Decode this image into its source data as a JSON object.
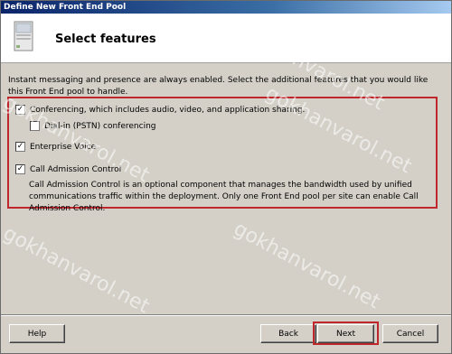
{
  "window": {
    "title": "Define New Front End Pool"
  },
  "header": {
    "title": "Select features",
    "icon": "server-icon"
  },
  "intro_text": "Instant messaging and presence are always enabled.  Select the additional features that you would like this Front End pool to handle.",
  "options": [
    {
      "label": "Conferencing, which includes audio, video, and application sharing.",
      "checked": true
    },
    {
      "label": "Dial-in (PSTN) conferencing",
      "checked": false
    },
    {
      "label": "Enterprise Voice",
      "checked": true
    },
    {
      "label": "Call Admission Control",
      "checked": true
    }
  ],
  "cac_description": "Call Admission Control is an optional component that manages the bandwidth used by unified communications traffic within the deployment.  Only one Front End pool per site can enable Call Admission Control.",
  "buttons": {
    "help": "Help",
    "back": "Back",
    "next": "Next",
    "cancel": "Cancel"
  },
  "watermark": "gokhanvarol.net",
  "colors": {
    "highlight": "#c0272d",
    "titlebar": "#0a246a",
    "dialog_bg": "#d4d0c8"
  }
}
